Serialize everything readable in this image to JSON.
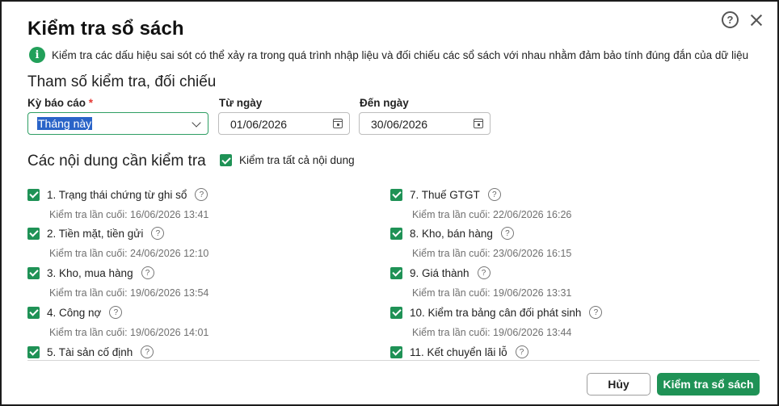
{
  "dialog": {
    "title": "Kiểm tra sổ sách",
    "info": "Kiểm tra các dấu hiệu sai sót có thể xảy ra trong quá trình nhập liệu và đối chiếu các sổ sách với nhau nhằm đảm bảo tính đúng đắn của dữ liệu",
    "help_icon": "question-circle-icon",
    "close_icon": "close-icon"
  },
  "params": {
    "section_title": "Tham số kiểm tra, đối chiếu",
    "period_label": "Kỳ báo cáo",
    "required_mark": "*",
    "period_value": "Tháng này",
    "from_label": "Từ ngày",
    "from_value": "01/06/2026",
    "to_label": "Đến ngày",
    "to_value": "30/06/2026"
  },
  "contents": {
    "section_title": "Các nội dung cần kiểm tra",
    "check_all_label": "Kiểm tra tất cả nội dung",
    "check_all_checked": true,
    "items": [
      {
        "label": "1. Trạng thái chứng từ ghi sổ",
        "last": "Kiểm tra lần cuối: 16/06/2026 13:41",
        "checked": true
      },
      {
        "label": "2. Tiền mặt, tiền gửi",
        "last": "Kiểm tra lần cuối: 24/06/2026 12:10",
        "checked": true
      },
      {
        "label": "3. Kho, mua hàng",
        "last": "Kiểm tra lần cuối: 19/06/2026 13:54",
        "checked": true
      },
      {
        "label": "4. Công nợ",
        "last": "Kiểm tra lần cuối: 19/06/2026 14:01",
        "checked": true
      },
      {
        "label": "5. Tài sản cố định",
        "last": "",
        "checked": true
      },
      {
        "label": "7. Thuế GTGT",
        "last": "Kiểm tra lần cuối: 22/06/2026 16:26",
        "checked": true
      },
      {
        "label": "8. Kho, bán hàng",
        "last": "Kiểm tra lần cuối: 23/06/2026 16:15",
        "checked": true
      },
      {
        "label": "9. Giá thành",
        "last": "Kiểm tra lần cuối: 19/06/2026 13:31",
        "checked": true
      },
      {
        "label": "10. Kiểm tra bảng cân đối phát sinh",
        "last": "Kiểm tra lần cuối: 19/06/2026 13:44",
        "checked": true
      },
      {
        "label": "11. Kết chuyển lãi lỗ",
        "last": "",
        "checked": true
      }
    ]
  },
  "footer": {
    "cancel_label": "Hủy",
    "submit_label": "Kiểm tra sổ sách"
  },
  "colors": {
    "accent": "#1f9256",
    "info_icon": "#22a05a",
    "selection": "#2a64c8"
  }
}
